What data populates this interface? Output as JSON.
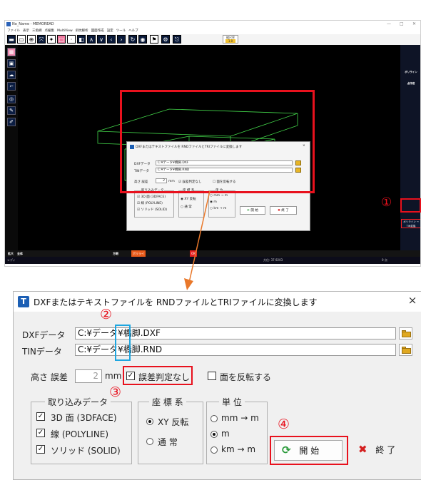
{
  "app": {
    "title": "No_Name - MEMOREAD",
    "window_controls": [
      "—",
      "□",
      "✕"
    ],
    "menu": [
      "ファイル",
      "表示",
      "三角網",
      "点編集",
      "MultiView",
      "斜坑解析",
      "図面作成",
      "設定",
      "ツール",
      "ヘルプ"
    ],
    "scale_label": "縮尺率",
    "scale_value": "1.0",
    "right_panel": {
      "items": [
        "",
        "",
        "ポリライン",
        "点作成",
        "",
        "",
        "",
        "",
        "",
        "",
        "",
        "",
        "",
        "",
        "",
        "",
        "",
        "",
        "",
        ""
      ],
      "selected": "ポリライン → TIN変換"
    },
    "bottom_bar": [
      "拡大",
      "全体",
      "",
      "",
      "",
      "",
      "",
      "",
      "",
      "",
      "",
      "",
      "方眼",
      "",
      "",
      "ポリライ",
      "",
      "",
      "",
      "",
      "",
      "",
      "",
      "OK"
    ],
    "status": {
      "left": "レディ",
      "coord": "方位: 37.9203",
      "right": "0 点"
    },
    "small_dialog": {
      "title": "DXFまたはテキストファイルを RNDファイルとTRIファイルに変換します",
      "dxf_label": "DXFデータ",
      "dxf_value": "C:¥データ¥橋脚.DXF",
      "tin_label": "TINデータ",
      "tin_value": "C:¥データ¥橋脚.RND",
      "height_label": "高さ 誤差",
      "height_value": "2",
      "height_unit": "mm",
      "error_check": "誤差判定なし",
      "flip": "面を反転する",
      "import_title": "取り込みデータ",
      "import_items": [
        "3D 面 (3DFACE)",
        "線 (POLYLINE)",
        "ソリッド (SOLID)"
      ],
      "coord_title": "座 標 系",
      "coord_items": [
        "XY 反転",
        "通 常"
      ],
      "unit_title": "単 位",
      "unit_items": [
        "mm → m",
        "m",
        "km → m"
      ],
      "start": "開 始",
      "end": "終 了"
    }
  },
  "annotations": {
    "c1": "①",
    "c2": "②",
    "c3": "③",
    "c4": "④"
  },
  "dialog": {
    "title": "DXFまたはテキストファイルを RNDファイルとTRIファイルに変換します",
    "close": "×",
    "dxf_label": "DXFデータ",
    "dxf_value": "C:¥データ¥橋脚.DXF",
    "tin_label": "TINデータ",
    "tin_value": "C:¥データ¥橋脚.RND",
    "height_label": "高さ 誤差",
    "height_value": "2",
    "height_unit": "mm",
    "error_check_label": "誤差判定なし",
    "flip_label": "面を反転する",
    "import_group": {
      "title": "取り込みデータ",
      "items": [
        {
          "label": "3D 面 (3DFACE)",
          "checked": true
        },
        {
          "label": "線 (POLYLINE)",
          "checked": true
        },
        {
          "label": "ソリッド (SOLID)",
          "checked": true
        }
      ]
    },
    "coord_group": {
      "title": "座 標 系",
      "items": [
        {
          "label": "XY 反転",
          "selected": true
        },
        {
          "label": "通 常",
          "selected": false
        }
      ]
    },
    "unit_group": {
      "title": "単 位",
      "items": [
        {
          "label": "mm → m",
          "selected": false
        },
        {
          "label": "m",
          "selected": true
        },
        {
          "label": "km → m",
          "selected": false
        }
      ]
    },
    "start_label": "開 始",
    "end_label": "終 了"
  },
  "colors": {
    "annotation": "#e8111d",
    "highlight_blue": "#1ea6e0",
    "arrow": "#e9782a",
    "wire": "#43d64a"
  }
}
